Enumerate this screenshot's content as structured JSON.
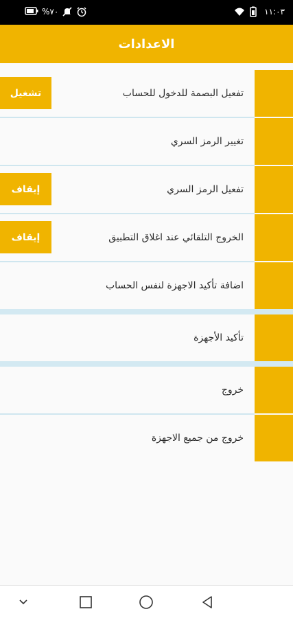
{
  "status": {
    "left_percent": "%٧٠",
    "time": "١١:٠٣",
    "icons_left": [
      "battery-icon",
      "mute-icon",
      "alarm-icon"
    ],
    "icons_right": [
      "wifi-icon",
      "battery-saver-icon"
    ]
  },
  "header": {
    "title": "الاعدادات"
  },
  "settings": [
    {
      "label": "تفعيل البصمة للدخول للحساب",
      "button": "تشغيل"
    },
    {
      "label": "تغيير الرمز السري",
      "button": ""
    },
    {
      "label": "تفعيل الرمز السري",
      "button": "إيقاف"
    },
    {
      "label": "الخروج التلقائي عند اغلاق التطبيق",
      "button": "إيقاف"
    },
    {
      "label": "اضافة تأكيد الاجهزة لنفس الحساب",
      "button": ""
    },
    {
      "label": "تأكيد الأجهزة",
      "button": ""
    },
    {
      "label": "خروج",
      "button": ""
    },
    {
      "label": "خروج من جميع الاجهزة",
      "button": ""
    }
  ],
  "colors": {
    "accent": "#f0b400",
    "divider": "#cfe6ef",
    "background": "#fafafa"
  }
}
